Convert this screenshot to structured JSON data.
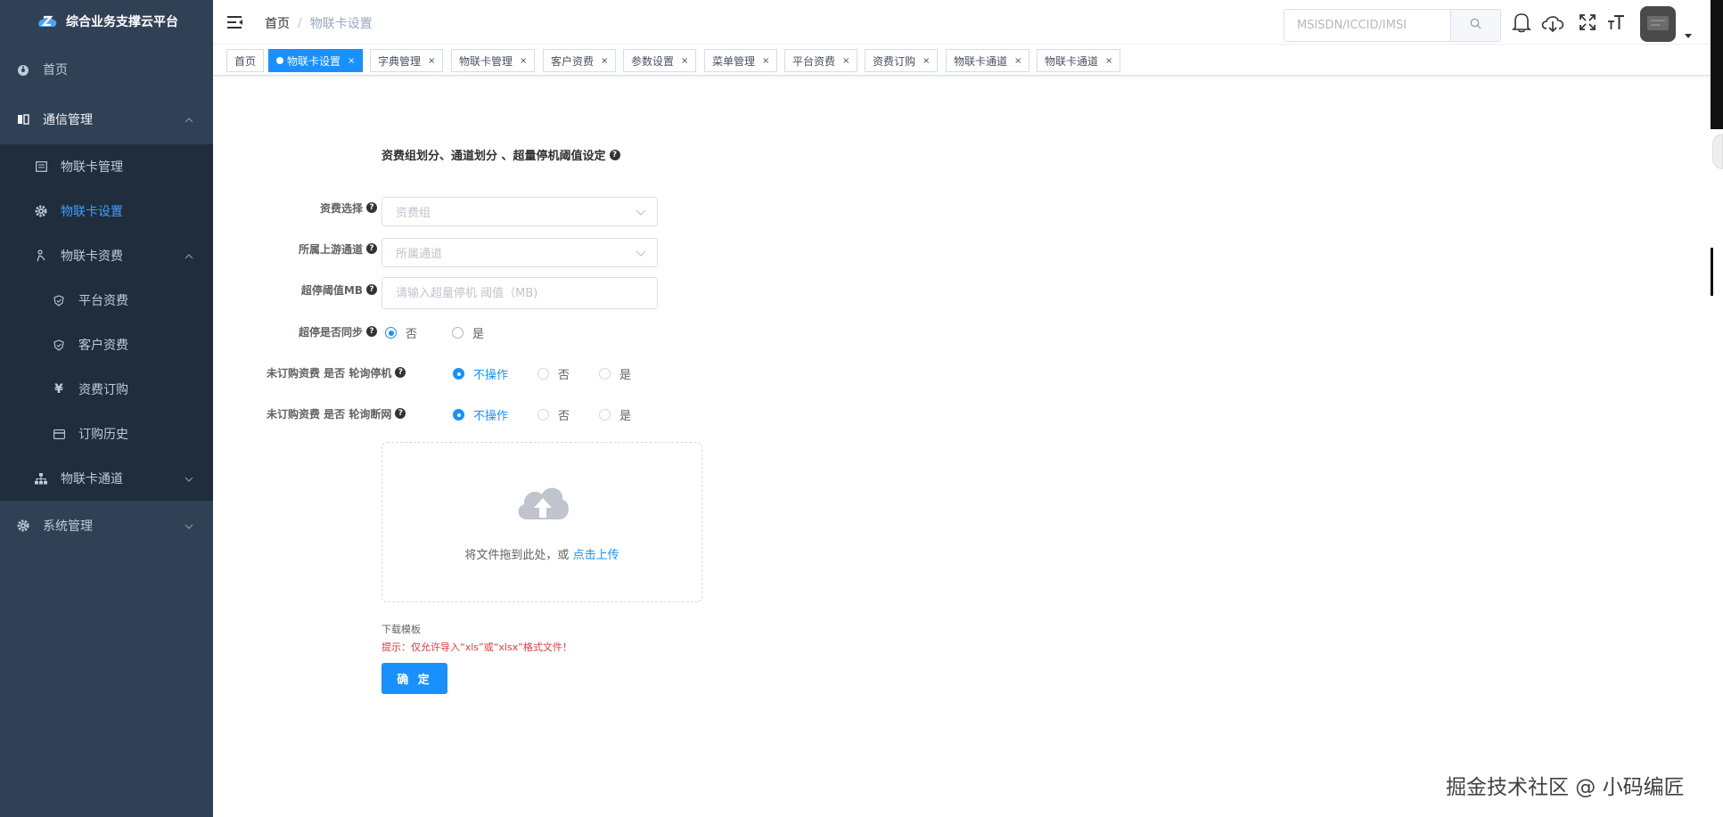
{
  "app": {
    "title": "综合业务支撑云平台"
  },
  "sidebar": {
    "home": "首页",
    "comm_mgmt": "通信管理",
    "card_mgmt": "物联卡管理",
    "card_settings": "物联卡设置",
    "card_tariff": "物联卡资费",
    "platform_tariff": "平台资费",
    "customer_tariff": "客户资费",
    "tariff_order": "资费订购",
    "order_history": "订购历史",
    "card_channel": "物联卡通道",
    "sys_mgmt": "系统管理"
  },
  "header": {
    "breadcrumb_home": "首页",
    "breadcrumb_sep": "/",
    "breadcrumb_current": "物联卡设置",
    "search_placeholder": "MSISDN/ICCID/IMSI"
  },
  "tags": [
    {
      "label": "首页",
      "closable": false,
      "active": false
    },
    {
      "label": "物联卡设置",
      "closable": true,
      "active": true
    },
    {
      "label": "字典管理",
      "closable": true,
      "active": false
    },
    {
      "label": "物联卡管理",
      "closable": true,
      "active": false
    },
    {
      "label": "客户资费",
      "closable": true,
      "active": false
    },
    {
      "label": "参数设置",
      "closable": true,
      "active": false
    },
    {
      "label": "菜单管理",
      "closable": true,
      "active": false
    },
    {
      "label": "平台资费",
      "closable": true,
      "active": false
    },
    {
      "label": "资费订购",
      "closable": true,
      "active": false
    },
    {
      "label": "物联卡通道",
      "closable": true,
      "active": false
    },
    {
      "label": "物联卡通道",
      "closable": true,
      "active": false
    }
  ],
  "tag_close": "×",
  "form": {
    "title": "资费组划分、通道划分 、超量停机阈值设定",
    "tariff_label": "资费选择",
    "tariff_placeholder": "资费组",
    "channel_label": "所属上游通道",
    "channel_placeholder": "所属通道",
    "threshold_label": "超停阈值MB",
    "threshold_placeholder": "请输入超量停机 阈值（MB)",
    "sync_label": "超停是否同步",
    "sync_no": "否",
    "sync_yes": "是",
    "poll_stop_label": "未订购资费 是否 轮询停机",
    "poll_break_label": "未订购资费 是否 轮询断网",
    "opt_noop": "不操作",
    "opt_no": "否",
    "opt_yes": "是",
    "upload_text": "将文件拖到此处，或",
    "upload_link": "点击上传",
    "download_template": "下载模板",
    "hint": "提示：仅允许导入“xls”或“xlsx”格式文件！",
    "confirm": "确 定"
  },
  "watermark": "掘金技术社区 @ 小码编匠",
  "colors": {
    "sidebar_bg": "#304156",
    "submenu_bg": "#1f2d3d",
    "primary": "#1890ff",
    "danger": "#e4393c"
  }
}
